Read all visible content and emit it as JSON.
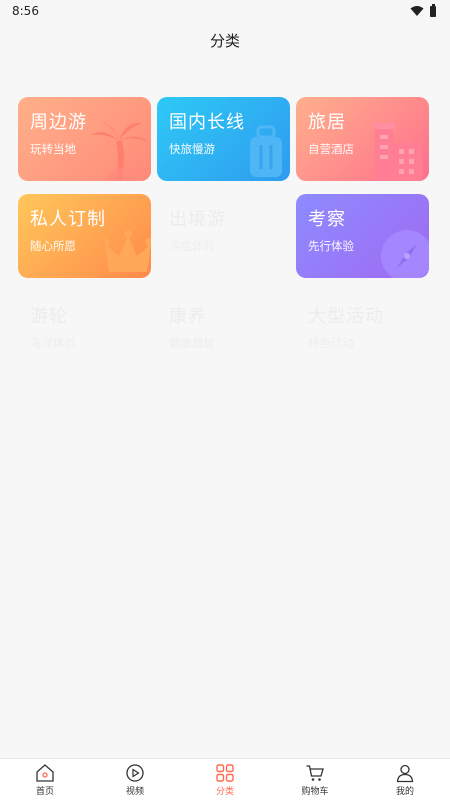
{
  "status": {
    "time": "8:56"
  },
  "header": {
    "title": "分类"
  },
  "categories": [
    {
      "title": "周边游",
      "subtitle": "玩转当地",
      "style": "orange",
      "icon": "palm-tree-icon"
    },
    {
      "title": "国内长线",
      "subtitle": "快旅慢游",
      "style": "cyan",
      "icon": "luggage-icon"
    },
    {
      "title": "旅居",
      "subtitle": "自营酒店",
      "style": "pink",
      "icon": "building-icon"
    },
    {
      "title": "私人订制",
      "subtitle": "随心所愿",
      "style": "yellow",
      "icon": "crown-icon"
    },
    {
      "title": "出境游",
      "subtitle": "深度体验",
      "style": "blank"
    },
    {
      "title": "考察",
      "subtitle": "先行体验",
      "style": "purple",
      "icon": "compass-icon"
    },
    {
      "title": "游轮",
      "subtitle": "海洋体验",
      "style": "blank"
    },
    {
      "title": "康养",
      "subtitle": "健康旅居",
      "style": "blank"
    },
    {
      "title": "大型活动",
      "subtitle": "特色活动",
      "style": "blank"
    }
  ],
  "tabbar": {
    "active": "分类",
    "items": [
      {
        "label": "首页",
        "icon": "home-icon"
      },
      {
        "label": "视频",
        "icon": "play-circle-icon"
      },
      {
        "label": "分类",
        "icon": "grid-icon"
      },
      {
        "label": "购物车",
        "icon": "cart-icon"
      },
      {
        "label": "我的",
        "icon": "user-icon"
      }
    ]
  },
  "colors": {
    "accent": "#ff6a4d"
  }
}
